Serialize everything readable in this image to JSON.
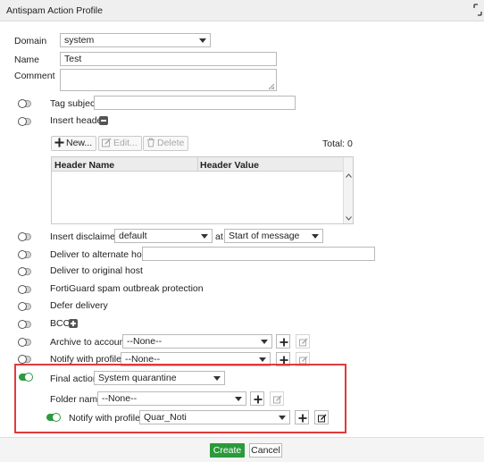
{
  "window": {
    "title": "Antispam Action Profile"
  },
  "fields": {
    "domain_label": "Domain",
    "domain_value": "system",
    "name_label": "Name",
    "name_value": "Test",
    "comment_label": "Comment",
    "comment_value": ""
  },
  "options": {
    "tag_subject": {
      "label": "Tag subject",
      "enabled": false,
      "value": ""
    },
    "insert_header": {
      "label": "Insert header",
      "enabled": false
    },
    "insert_disclaimer": {
      "label": "Insert disclaimer",
      "enabled": false,
      "value": "default",
      "at_label": "at",
      "position": "Start of message"
    },
    "deliver_alternate": {
      "label": "Deliver to alternate host",
      "enabled": false,
      "value": ""
    },
    "deliver_original": {
      "label": "Deliver to original host",
      "enabled": false
    },
    "fortiguard": {
      "label": "FortiGuard spam outbreak protection",
      "enabled": false
    },
    "defer": {
      "label": "Defer delivery",
      "enabled": false
    },
    "bcc": {
      "label": "BCC",
      "enabled": false
    },
    "archive": {
      "label": "Archive to account",
      "enabled": false,
      "value": "--None--"
    },
    "notify": {
      "label": "Notify with profile",
      "enabled": false,
      "value": "--None--"
    },
    "final_action": {
      "label": "Final action",
      "enabled": true,
      "value": "System quarantine"
    },
    "folder_name": {
      "label": "Folder name",
      "value": "--None--"
    },
    "final_notify": {
      "label": "Notify with profile",
      "enabled": true,
      "value": "Quar_Noti"
    }
  },
  "header_table": {
    "toolbar": {
      "new": "New...",
      "edit": "Edit...",
      "delete": "Delete",
      "total": "Total: 0"
    },
    "columns": [
      "Header Name",
      "Header Value"
    ],
    "rows": []
  },
  "footer": {
    "create": "Create",
    "cancel": "Cancel"
  },
  "colors": {
    "accent_green": "#2a9a3a",
    "highlight_red": "#e03a3a"
  }
}
